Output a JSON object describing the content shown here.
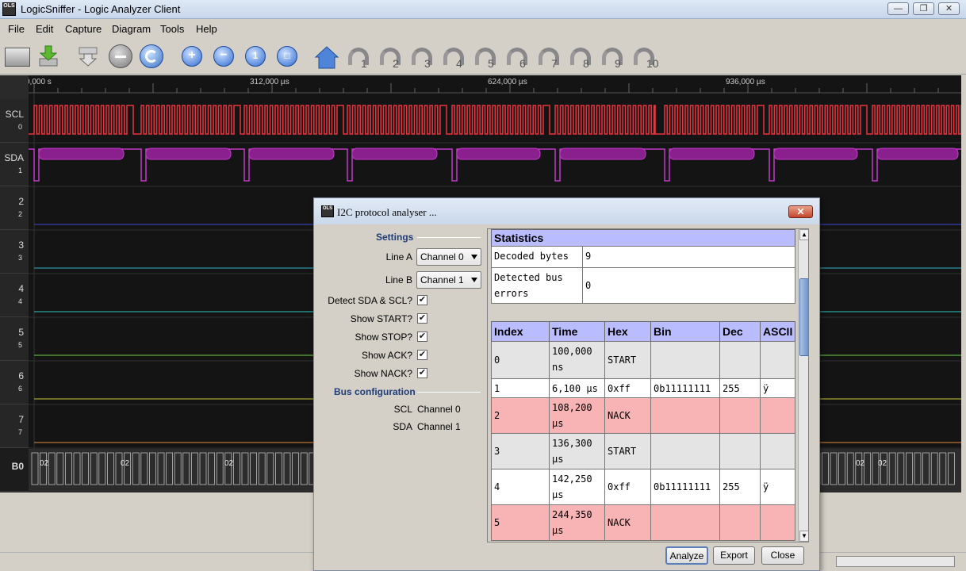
{
  "window": {
    "title": "LogicSniffer - Logic Analyzer Client",
    "icon_text": "OLS"
  },
  "menu": [
    "File",
    "Edit",
    "Capture",
    "Diagram",
    "Tools",
    "Help"
  ],
  "toolbar": {
    "bookmarks": [
      "1",
      "2",
      "3",
      "4",
      "5",
      "6",
      "7",
      "8",
      "9",
      "10"
    ]
  },
  "ruler": [
    "0,000 s",
    "312,000 µs",
    "624,000 µs",
    "936,000 µs"
  ],
  "channels": [
    {
      "name": "SCL",
      "index": "0"
    },
    {
      "name": "SDA",
      "index": "1"
    },
    {
      "name": "2",
      "index": "2"
    },
    {
      "name": "3",
      "index": "3"
    },
    {
      "name": "4",
      "index": "4"
    },
    {
      "name": "5",
      "index": "5"
    },
    {
      "name": "6",
      "index": "6"
    },
    {
      "name": "7",
      "index": "7"
    },
    {
      "name": "B0",
      "index": ""
    }
  ],
  "bus_values": [
    "02",
    "02",
    "02",
    "02",
    "02"
  ],
  "dialog": {
    "title": "I2C protocol analyser ...",
    "settings_heading": "Settings",
    "line_a_label": "Line A",
    "line_a_value": "Channel 0",
    "line_b_label": "Line B",
    "line_b_value": "Channel 1",
    "detect_label": "Detect SDA & SCL?",
    "show_start_label": "Show START?",
    "show_stop_label": "Show STOP?",
    "show_ack_label": "Show ACK?",
    "show_nack_label": "Show NACK?",
    "check_mark": "✔",
    "bus_heading": "Bus configuration",
    "scl_label": "SCL",
    "scl_value": "Channel 0",
    "sda_label": "SDA",
    "sda_value": "Channel 1",
    "stats_heading": "Statistics",
    "decoded_label": "Decoded bytes",
    "decoded_value": "9",
    "errors_label": "Detected bus errors",
    "errors_value": "0",
    "columns": [
      "Index",
      "Time",
      "Hex",
      "Bin",
      "Dec",
      "ASCII"
    ],
    "rows": [
      {
        "index": "0",
        "time": "100,000 ns",
        "hex": "START",
        "bin": "",
        "dec": "",
        "ascii": "",
        "color": "#e4e4e4"
      },
      {
        "index": "1",
        "time": "6,100 µs",
        "hex": "0xff",
        "bin": "0b11111111",
        "dec": "255",
        "ascii": "ÿ",
        "color": "#ffffff"
      },
      {
        "index": "2",
        "time": "108,200 µs",
        "hex": "NACK",
        "bin": "",
        "dec": "",
        "ascii": "",
        "color": "#f8b4b4"
      },
      {
        "index": "3",
        "time": "136,300 µs",
        "hex": "START",
        "bin": "",
        "dec": "",
        "ascii": "",
        "color": "#e4e4e4"
      },
      {
        "index": "4",
        "time": "142,250 µs",
        "hex": "0xff",
        "bin": "0b11111111",
        "dec": "255",
        "ascii": "ÿ",
        "color": "#ffffff"
      },
      {
        "index": "5",
        "time": "244,350 µs",
        "hex": "NACK",
        "bin": "",
        "dec": "",
        "ascii": "",
        "color": "#f8b4b4"
      }
    ],
    "analyze_label": "Analyze",
    "export_label": "Export",
    "close_label": "Close"
  },
  "colors": {
    "scl": "#e8343e",
    "sda": "#c23bc8",
    "ch2": "#3c46d4",
    "ch3": "#2fb0c8",
    "ch4": "#31c9c2",
    "ch5": "#6fd24a",
    "ch6": "#c9c83a",
    "ch7": "#e08a3c"
  }
}
